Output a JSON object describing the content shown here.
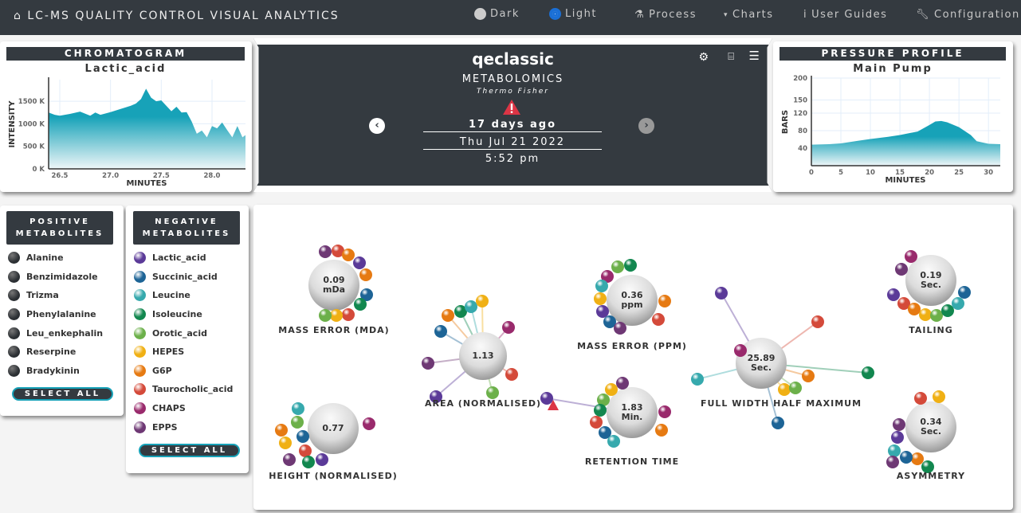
{
  "nav": {
    "brand": "LC-MS QUALITY CONTROL VISUAL ANALYTICS",
    "dark": "Dark",
    "light": "Light",
    "process": "Process",
    "charts": "Charts",
    "guides": "User Guides",
    "config": "Configuration",
    "theme_selected": "Light"
  },
  "chromatogram": {
    "title": "CHROMATOGRAM",
    "subtitle": "Lactic_acid",
    "ylabel": "INTENSITY",
    "xlabel": "MINUTES",
    "chart_data": {
      "type": "area",
      "x": [
        26.39,
        26.45,
        26.5,
        26.6,
        26.7,
        26.8,
        26.85,
        26.9,
        27.0,
        27.1,
        27.2,
        27.25,
        27.3,
        27.35,
        27.4,
        27.45,
        27.5,
        27.6,
        27.65,
        27.7,
        27.75,
        27.8,
        27.85,
        27.9,
        27.95,
        28.0,
        28.05,
        28.1,
        28.15,
        28.2,
        28.25,
        28.3,
        28.33
      ],
      "y": [
        1250,
        1200,
        1180,
        1220,
        1270,
        1180,
        1250,
        1200,
        1260,
        1330,
        1400,
        1450,
        1550,
        1780,
        1580,
        1500,
        1520,
        1280,
        1380,
        1250,
        1260,
        1050,
        780,
        850,
        700,
        950,
        900,
        1030,
        860,
        700,
        950,
        700,
        750
      ],
      "xticks": [
        "26.5",
        "27.0",
        "27.5",
        "28.0"
      ],
      "yticks": [
        "0 K",
        "500 K",
        "1000 K",
        "1500 K"
      ],
      "xlim": [
        26.39,
        28.33
      ],
      "ylim": [
        0,
        1980
      ]
    }
  },
  "pressure": {
    "title": "PRESSURE PROFILE",
    "subtitle": "Main Pump",
    "ylabel": "BARS",
    "xlabel": "MINUTES",
    "chart_data": {
      "type": "area",
      "x": [
        0,
        3,
        5,
        8,
        10,
        13,
        15,
        18,
        20,
        21,
        22,
        23,
        25,
        27,
        28,
        30,
        32
      ],
      "y": [
        48,
        49,
        51,
        57,
        61,
        66,
        70,
        78,
        93,
        101,
        102,
        99,
        88,
        70,
        56,
        50,
        49
      ],
      "xticks": [
        "0",
        "5",
        "10",
        "15",
        "20",
        "25",
        "30"
      ],
      "yticks": [
        "40",
        "80",
        "120",
        "150",
        "200"
      ],
      "xlim": [
        0,
        32
      ],
      "ylim": [
        0,
        200
      ]
    }
  },
  "sample": {
    "name": "qeclassic",
    "type": "METABOLOMICS",
    "vendor": "Thermo Fisher",
    "ago": "17 days ago",
    "date": "Thu Jul 21 2022",
    "time": "5:52 pm"
  },
  "positive": {
    "title1": "POSITIVE",
    "title2": "METABOLITES",
    "select_all": "SELECT ALL",
    "items": [
      "Alanine",
      "Benzimidazole",
      "Trizma",
      "Phenylalanine",
      "Leu_enkephalin",
      "Reserpine",
      "Bradykinin"
    ]
  },
  "negative": {
    "title1": "NEGATIVE",
    "title2": "METABOLITES",
    "select_all": "SELECT ALL",
    "items": [
      {
        "name": "Lactic_acid",
        "color": "#5b3a98"
      },
      {
        "name": "Succinic_acid",
        "color": "#1d6496"
      },
      {
        "name": "Leucine",
        "color": "#36a9ad"
      },
      {
        "name": "Isoleucine",
        "color": "#12874f"
      },
      {
        "name": "Orotic_acid",
        "color": "#6cb04a"
      },
      {
        "name": "HEPES",
        "color": "#f0b014"
      },
      {
        "name": "G6P",
        "color": "#e67a12"
      },
      {
        "name": "Taurocholic_acid",
        "color": "#d44a3a"
      },
      {
        "name": "CHAPS",
        "color": "#992a6c"
      },
      {
        "name": "EPPS",
        "color": "#6e3874"
      }
    ]
  },
  "metrics": [
    {
      "label": "MASS ERROR (MDA)",
      "value": "0.09",
      "unit": "mDa"
    },
    {
      "label": "AREA (NORMALISED)",
      "value": "1.13",
      "unit": ""
    },
    {
      "label": "MASS ERROR (PPM)",
      "value": "0.36",
      "unit": "ppm"
    },
    {
      "label": "RETENTION TIME",
      "value": "1.83",
      "unit": "Min."
    },
    {
      "label": "FULL WIDTH HALF MAXIMUM",
      "value": "25.89",
      "unit": "Sec."
    },
    {
      "label": "TAILING",
      "value": "0.19",
      "unit": "Sec."
    },
    {
      "label": "HEIGHT (NORMALISED)",
      "value": "0.77",
      "unit": ""
    },
    {
      "label": "ASYMMETRY",
      "value": "0.34",
      "unit": "Sec."
    }
  ],
  "colors": {
    "dark": "#343a40",
    "accent": "#17a2b8",
    "warning": "#dc3545"
  }
}
